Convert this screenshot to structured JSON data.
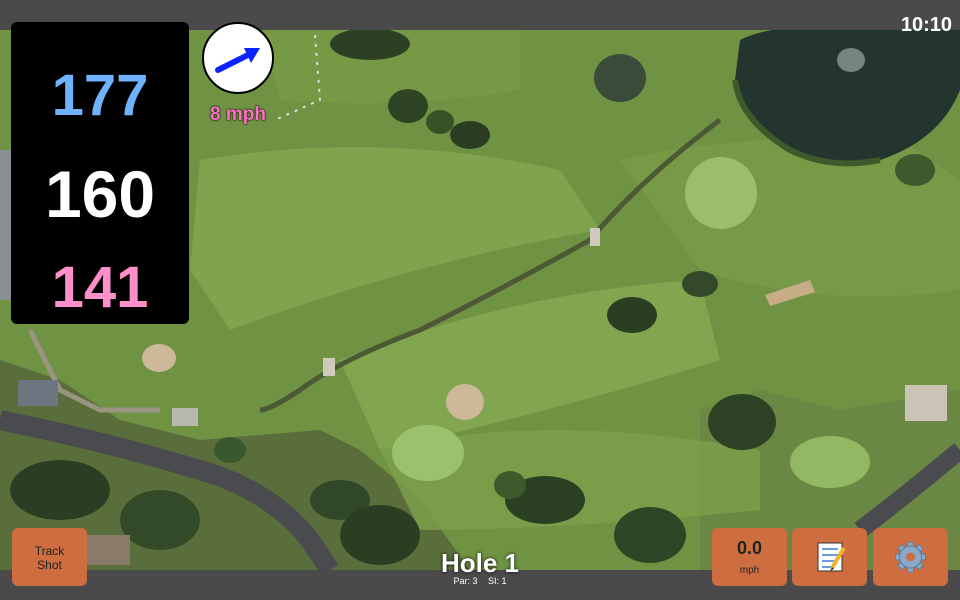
{
  "status": {
    "time": "10:10"
  },
  "yardage": {
    "back": "177",
    "center": "160",
    "front": "141"
  },
  "wind": {
    "speed_label": "8 mph",
    "arrow_icon": "wind-direction-arrow-icon"
  },
  "hole": {
    "title": "Hole 1",
    "par": "Par: 3",
    "si": "SI: 1"
  },
  "buttons": {
    "track_shot_line1": "Track",
    "track_shot_line2": "Shot",
    "wind_value": "0.0",
    "wind_unit": "mph",
    "notes_icon": "notepad-icon",
    "settings_icon": "gear-icon"
  },
  "colors": {
    "button": "#cd6d40",
    "back_yardage": "#6fb3ff",
    "front_yardage": "#ff8fcb",
    "wind_text": "#ff6fc4"
  }
}
